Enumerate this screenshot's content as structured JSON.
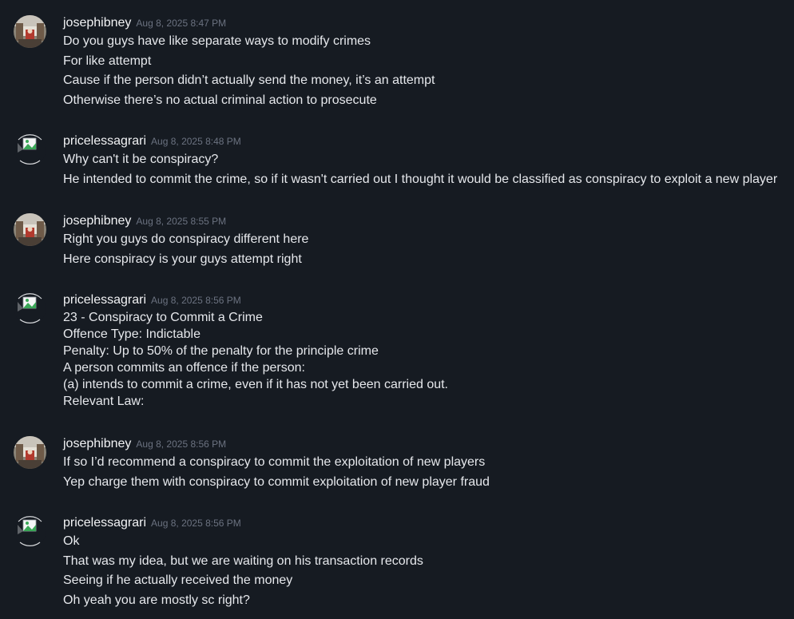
{
  "messages": [
    {
      "username": "josephibney",
      "timestamp": "Aug 8, 2025 8:47 PM",
      "avatar": "photo-avatar",
      "lines": [
        "Do you guys have like separate ways to modify crimes",
        "For like attempt",
        "Cause if the person didn’t actually send the money, it’s an attempt",
        "Otherwise there’s no actual criminal action to prosecute"
      ]
    },
    {
      "username": "pricelessagrari",
      "timestamp": "Aug 8, 2025 8:48 PM",
      "avatar": "broken-image-avatar",
      "lines": [
        "Why can't it be conspiracy?",
        "He intended to commit the crime, so if it wasn't carried out I thought it would be classified as conspiracy to exploit a new player"
      ]
    },
    {
      "username": "josephibney",
      "timestamp": "Aug 8, 2025 8:55 PM",
      "avatar": "photo-avatar",
      "lines": [
        "Right you guys do conspiracy different here",
        "Here conspiracy is your guys attempt right"
      ]
    },
    {
      "username": "pricelessagrari",
      "timestamp": "Aug 8, 2025 8:56 PM",
      "avatar": "broken-image-avatar",
      "lines": [
        "23 - Conspiracy to Commit a Crime",
        "Offence Type: Indictable",
        "Penalty: Up to 50% of the penalty for the principle crime",
        "A person commits an offence if the person:",
        "(a) intends to commit a crime, even if it has not yet been carried out.",
        "Relevant Law:"
      ]
    },
    {
      "username": "josephibney",
      "timestamp": "Aug 8, 2025 8:56 PM",
      "avatar": "photo-avatar",
      "lines": [
        "If so I’d recommend a conspiracy to commit the exploitation of new players",
        "Yep charge them with conspiracy to commit exploitation of new player fraud"
      ]
    },
    {
      "username": "pricelessagrari",
      "timestamp": "Aug 8, 2025 8:56 PM",
      "avatar": "broken-image-avatar",
      "lines": [
        "Ok",
        "That was my idea, but we are waiting on his transaction records",
        "Seeing if he actually received the money",
        "Oh yeah you are mostly sc right?"
      ]
    }
  ]
}
